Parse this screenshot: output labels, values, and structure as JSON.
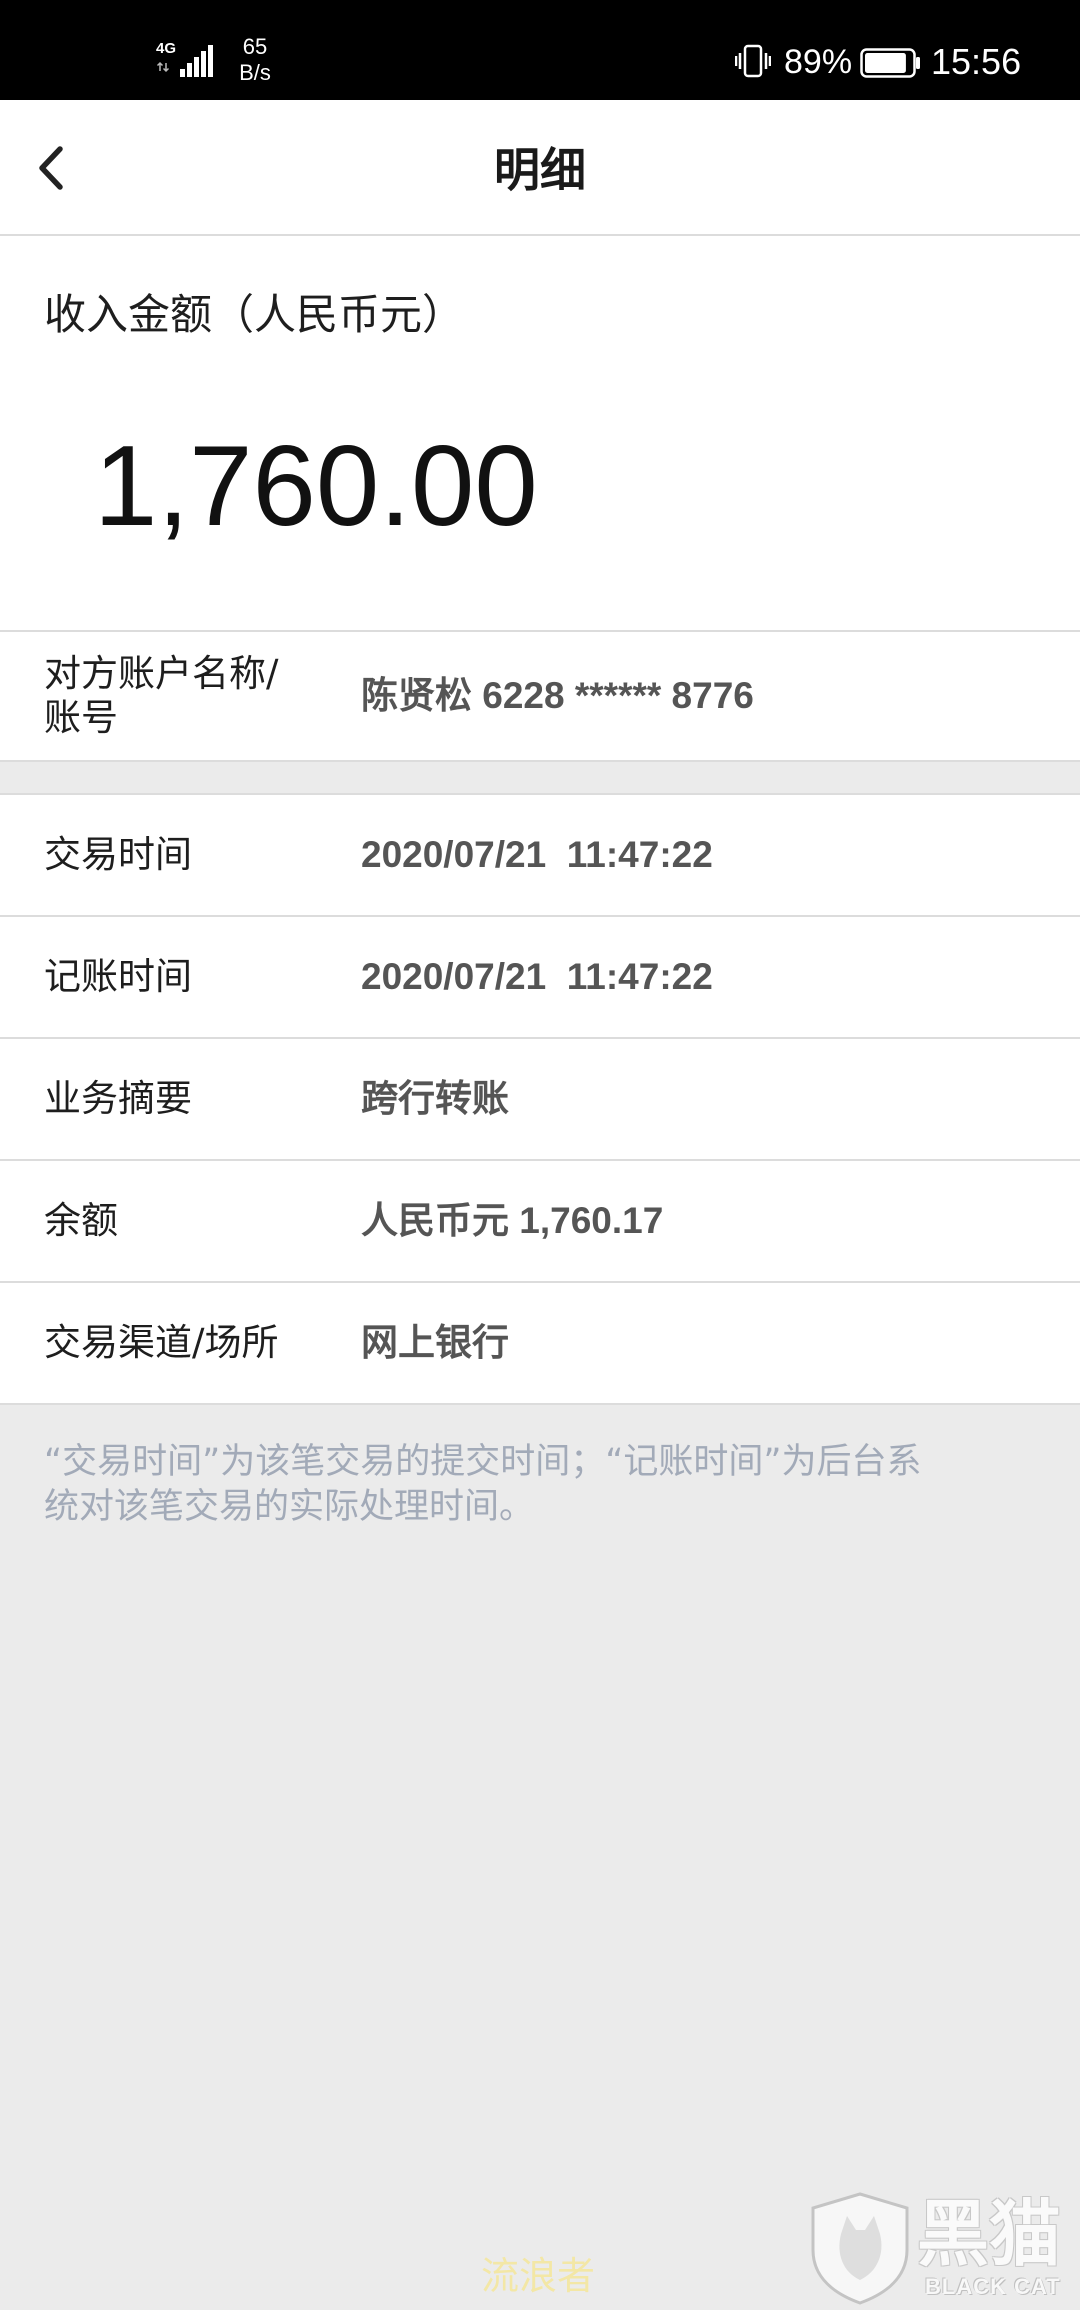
{
  "status_bar": {
    "network_label": "4G",
    "speed_value": "65",
    "speed_unit": "B/s",
    "battery_percent": "89%",
    "battery_level": 0.89,
    "time": "15:56",
    "icons": [
      "signal-icon",
      "vibrate-icon",
      "battery-icon"
    ]
  },
  "header": {
    "title": "明细",
    "back_icon": "chevron-left-icon"
  },
  "amount_section": {
    "label": "收入金额（人民币元）",
    "amount": "1,760.00"
  },
  "counterparty": {
    "label_line1": "对方账户名称/",
    "label_line2": "账号",
    "value": "陈贤松 6228 ****** 8776"
  },
  "details": [
    {
      "label": "交易时间",
      "value": "2020/07/21  11:47:22"
    },
    {
      "label": "记账时间",
      "value": "2020/07/21  11:47:22"
    },
    {
      "label": "业务摘要",
      "value": "跨行转账"
    },
    {
      "label": "余额",
      "value": "人民币元 1,760.17"
    },
    {
      "label": "交易渠道/场所",
      "value": "网上银行"
    }
  ],
  "note": {
    "line1": "“交易时间”为该笔交易的提交时间；“记账时间”为后台系",
    "line2": "统对该笔交易的实际处理时间。"
  },
  "watermarks": {
    "center_text": "流浪者",
    "logo_cn": "黑猫",
    "logo_en": "BLACK CAT",
    "logo_icon": "cat-shield-icon"
  },
  "colors": {
    "status_bar_bg": "#000000",
    "card_bg": "#ffffff",
    "page_bg": "#ebebeb",
    "label_text": "#1e1e1e",
    "value_text": "#555555",
    "note_text": "#a2aab8",
    "divider": "#dcdcdc",
    "watermark_text": "#f3e7a6"
  }
}
